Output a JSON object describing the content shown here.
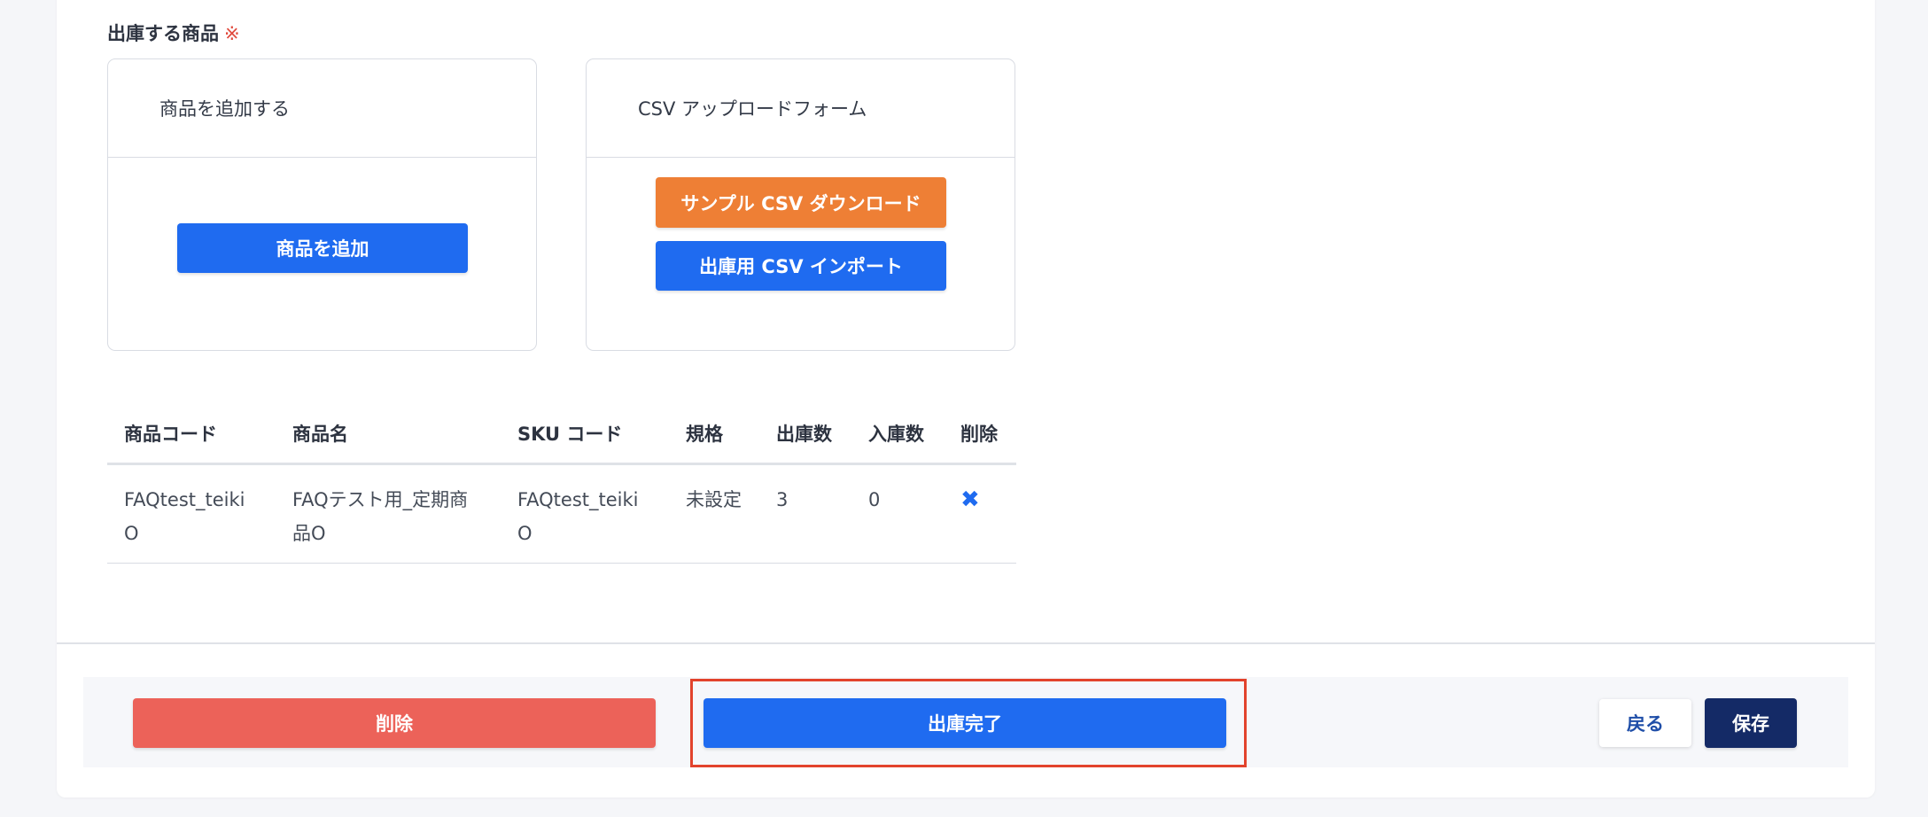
{
  "section": {
    "title": "出庫する商品",
    "required_mark": "※"
  },
  "add_card": {
    "header": "商品を追加する",
    "button": "商品を追加"
  },
  "csv_card": {
    "header": "CSV アップロードフォーム",
    "sample_button": "サンプル CSV ダウンロード",
    "import_button": "出庫用 CSV インポート"
  },
  "table": {
    "headers": [
      "商品コード",
      "商品名",
      "SKU コード",
      "規格",
      "出庫数",
      "入庫数",
      "削除"
    ],
    "rows": [
      {
        "code": "FAQtest_teikiO",
        "name": "FAQテスト用_定期商品O",
        "sku": "FAQtest_teikiO",
        "spec": "未設定",
        "out_qty": "3",
        "in_qty": "0",
        "delete_icon": "x-icon"
      }
    ]
  },
  "footer": {
    "delete_label": "削除",
    "complete_label": "出庫完了",
    "back_label": "戻る",
    "save_label": "保存"
  },
  "colors": {
    "primary": "#1f6bf0",
    "orange": "#ee7f35",
    "danger": "#ec6259",
    "navy": "#142a66",
    "highlight": "#e2432c"
  }
}
